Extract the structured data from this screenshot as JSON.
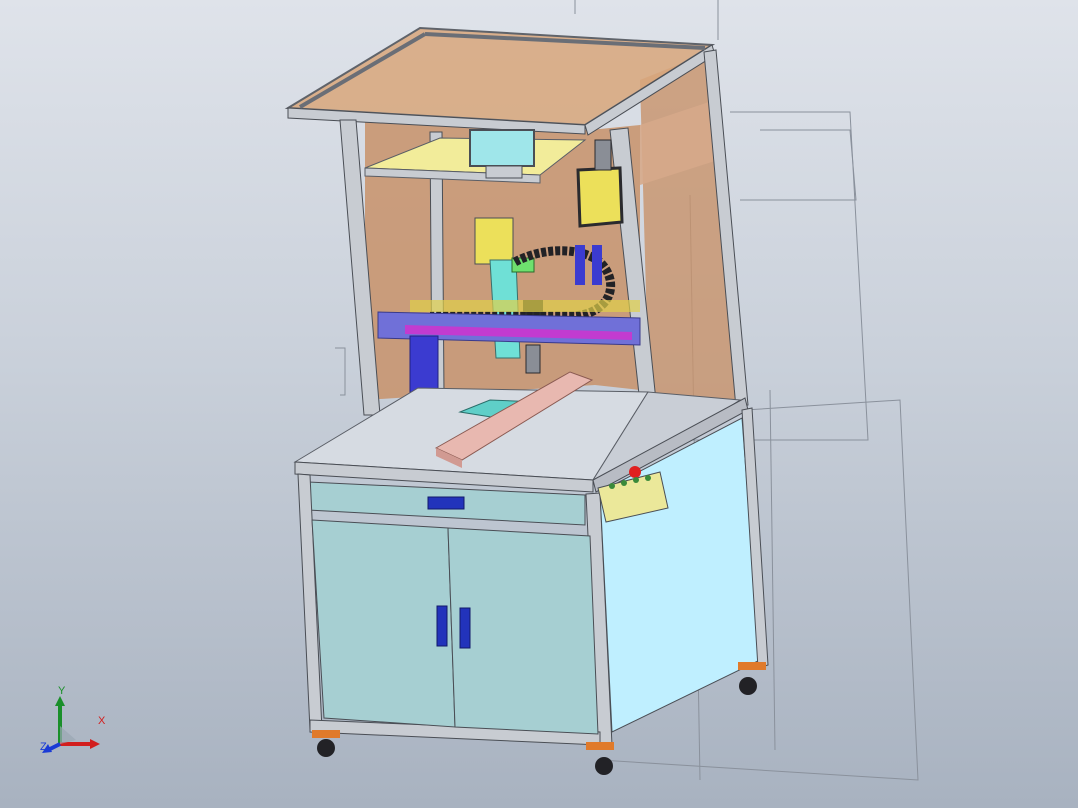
{
  "viewport": {
    "background_top": "#dfe3ea",
    "background_bottom": "#a8b2c0"
  },
  "colors": {
    "frame_aluminum": "#c8ccd2",
    "frame_dark": "#5a5e66",
    "enclosure_orange": "#c8926a",
    "roof_orange": "#d9a77c",
    "table_top": "#d6dbe2",
    "cabinet_door": "#a6cfd2",
    "side_panel": "#bfefff",
    "handle_blue": "#2233bb",
    "tray_yellow": "#f2ec9a",
    "carriage_yellow": "#ece05a",
    "axis_purple": "#7070d8",
    "axis_magenta": "#c23bd0",
    "z_axis_cyan": "#6fe0d6",
    "fixture_teal": "#5fcfc8",
    "linear_module_pink": "#e8b8b0",
    "monitor_cyan": "#9fe6ea",
    "control_box": "#ebe89a",
    "estop_red": "#e02020",
    "caster_orange": "#e07a2a",
    "cable_chain": "#222226"
  },
  "triad": {
    "x_label": "X",
    "y_label": "Y",
    "z_label": "Z",
    "x_color": "#d21e1e",
    "y_color": "#1a8f2a",
    "z_color": "#1a3bd6"
  }
}
